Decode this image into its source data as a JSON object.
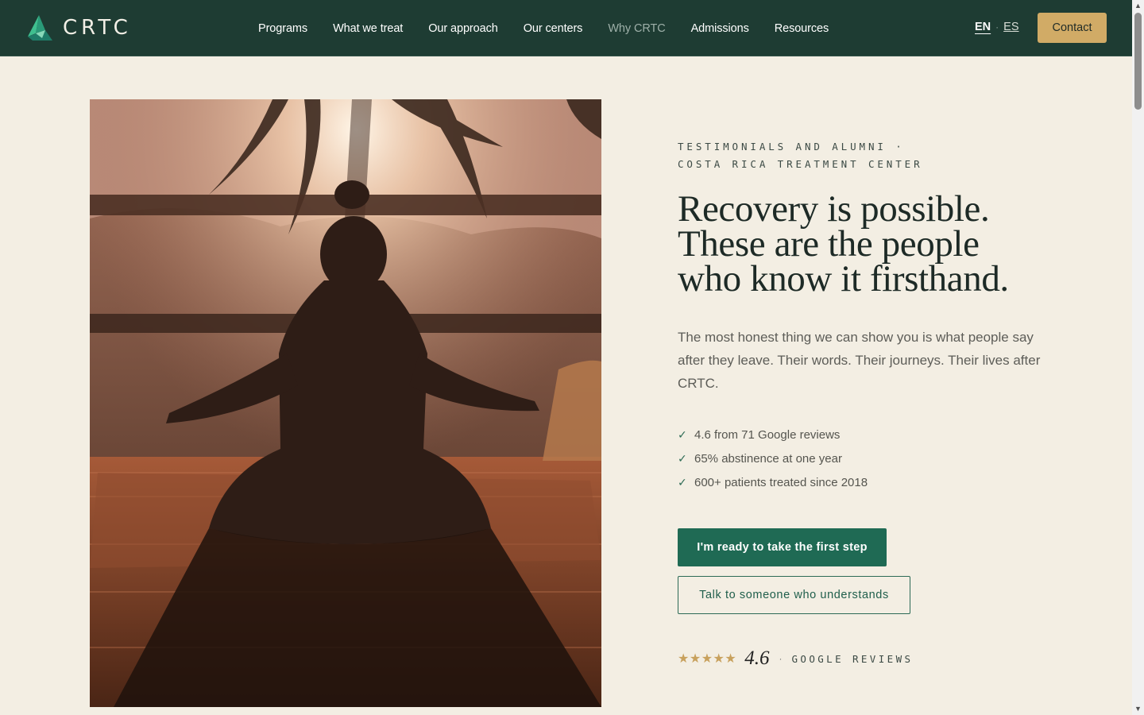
{
  "header": {
    "logo_text": "CRTC",
    "nav": [
      {
        "label": "Programs",
        "active": false
      },
      {
        "label": "What we treat",
        "active": false
      },
      {
        "label": "Our approach",
        "active": false
      },
      {
        "label": "Our centers",
        "active": false
      },
      {
        "label": "Why CRTC",
        "active": true
      },
      {
        "label": "Admissions",
        "active": false
      },
      {
        "label": "Resources",
        "active": false
      }
    ],
    "lang": {
      "current": "EN",
      "separator": "·",
      "other": "ES"
    },
    "contact_label": "Contact"
  },
  "hero": {
    "image_icon": "meditation-silhouette-photo",
    "eyebrow_line1": "TESTIMONIALS AND ALUMNI ·",
    "eyebrow_line2": "COSTA RICA TREATMENT CENTER",
    "headline_line1": "Recovery is possible.",
    "headline_line2": "These are the people",
    "headline_line3": "who know it firsthand.",
    "lead": "The most honest thing we can show you is what people say after they leave. Their words. Their journeys. Their lives after CRTC.",
    "checks": [
      "4.6 from 71 Google reviews",
      "65% abstinence at one year",
      "600+ patients treated since 2018"
    ],
    "check_icon": "✓",
    "primary_cta": "I'm ready to take the first step",
    "secondary_cta": "Talk to someone who understands",
    "rating": {
      "stars": "★★★★★",
      "score": "4.6",
      "separator": "·",
      "label": "GOOGLE REVIEWS"
    }
  },
  "colors": {
    "header_bg": "#1e3c33",
    "page_bg": "#f3eee3",
    "accent_gold": "#d1ab66",
    "primary_green": "#1f6a54"
  }
}
